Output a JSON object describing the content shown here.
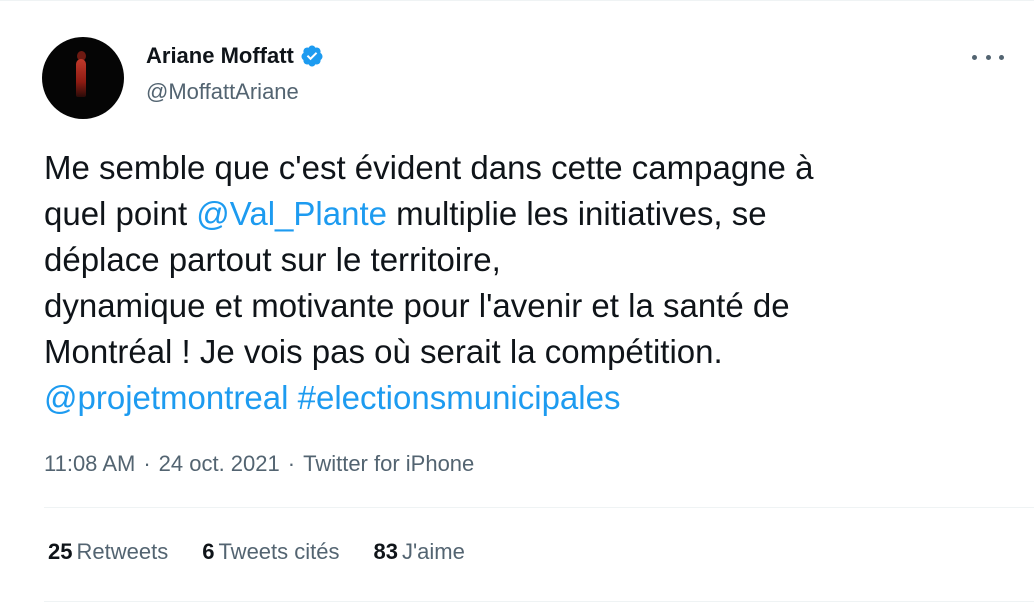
{
  "author": {
    "display_name": "Ariane Moffatt",
    "handle": "@MoffattAriane",
    "verified_icon": "verified-badge-icon"
  },
  "tweet": {
    "lines": [
      [
        {
          "text": "Me semble que c'est évident dans cette campagne à",
          "link": false
        }
      ],
      [
        {
          "text": "quel point ",
          "link": false
        },
        {
          "text": "@Val_Plante",
          "link": true
        },
        {
          "text": " multiplie les initiatives, se",
          "link": false
        }
      ],
      [
        {
          "text": "déplace partout sur le territoire,",
          "link": false
        }
      ],
      [
        {
          "text": "dynamique et motivante pour l'avenir et la santé de",
          "link": false
        }
      ],
      [
        {
          "text": "Montréal ! Je vois pas où serait la compétition.",
          "link": false
        }
      ],
      [
        {
          "text": "@projetmontreal",
          "link": true
        },
        {
          "text": " ",
          "link": false
        },
        {
          "text": "#electionsmunicipales",
          "link": true
        }
      ]
    ],
    "time": "11:08 AM",
    "separator": "·",
    "date": "24 oct. 2021",
    "source": "Twitter for iPhone"
  },
  "stats": {
    "retweets_count": "25",
    "retweets_label": "Retweets",
    "quotes_count": "6",
    "quotes_label": "Tweets cités",
    "likes_count": "83",
    "likes_label": "J'aime"
  },
  "colors": {
    "link": "#1d9bf0",
    "secondary_text": "#536471",
    "primary_text": "#0f1419",
    "divider": "#eff3f4"
  },
  "icons": {
    "more": "more-horizontal-icon"
  }
}
